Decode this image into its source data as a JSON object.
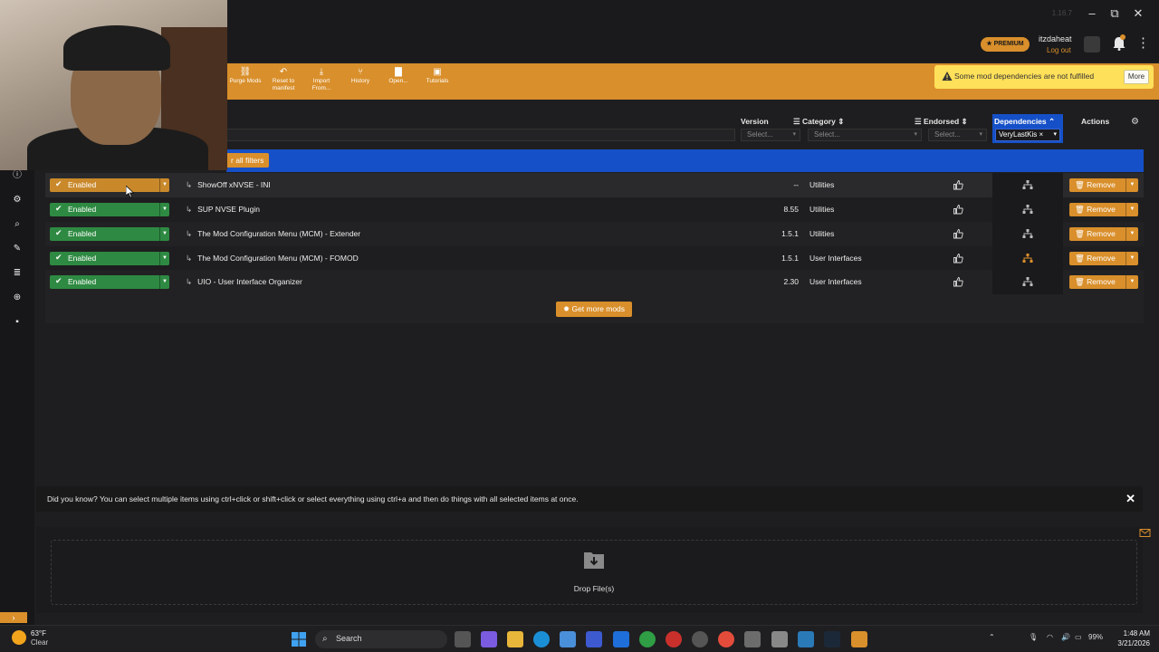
{
  "window": {
    "version": "1.16.7"
  },
  "header": {
    "premium_badge": "★ PREMIUM",
    "username": "itzdaheat",
    "logout": "Log out"
  },
  "toolbar": {
    "items": [
      {
        "icon": "link-icon",
        "label": "Purge Mods"
      },
      {
        "icon": "undo-icon",
        "label": "Reset to manifest"
      },
      {
        "icon": "import-icon",
        "label": "Import From..."
      },
      {
        "icon": "history-icon",
        "label": "History"
      },
      {
        "icon": "folder-icon",
        "label": "Open..."
      },
      {
        "icon": "tutorial-icon",
        "label": "Tutorials"
      }
    ]
  },
  "alert": {
    "text": "Some mod dependencies are not fulfilled",
    "button": "More",
    "color": "#ffe05a"
  },
  "columns": {
    "version": "Version",
    "category": "Category",
    "endorsed": "Endorsed",
    "dependencies": "Dependencies",
    "actions": "Actions",
    "version_filter": "Select...",
    "category_filter": "Select...",
    "endorsed_filter": "Select...",
    "dependencies_filter": "VeryLastKis"
  },
  "banner": {
    "button": "r all filters"
  },
  "mods": [
    {
      "status": "Enabled",
      "name": "ShowOff xNVSE - INI",
      "version": "--",
      "category": "Utilities",
      "action": "Remove",
      "dep_alert": false
    },
    {
      "status": "Enabled",
      "name": "SUP NVSE Plugin",
      "version": "8.55",
      "category": "Utilities",
      "action": "Remove",
      "dep_alert": false
    },
    {
      "status": "Enabled",
      "name": "The Mod Configuration Menu (MCM) - Extender",
      "version": "1.5.1",
      "category": "Utilities",
      "action": "Remove",
      "dep_alert": false
    },
    {
      "status": "Enabled",
      "name": "The Mod Configuration Menu (MCM) - FOMOD",
      "version": "1.5.1",
      "category": "User Interfaces",
      "action": "Remove",
      "dep_alert": true
    },
    {
      "status": "Enabled",
      "name": "UIO - User Interface Organizer",
      "version": "2.30",
      "category": "User Interfaces",
      "action": "Remove",
      "dep_alert": false
    }
  ],
  "get_more": "Get more mods",
  "tip": "Did you know? You can select multiple items using ctrl+click or shift+click or select everything using ctrl+a and then do things with all selected items at once.",
  "drop": "Drop File(s)",
  "taskbar": {
    "weather_temp": "63°F",
    "weather_state": "Clear",
    "search": "Search",
    "battery": "99%",
    "time": "1:48 AM",
    "date": "3/21/2026"
  },
  "colors": {
    "accent": "#d98f2b",
    "enabled": "#2e8a42",
    "selection": "#1550c8"
  }
}
